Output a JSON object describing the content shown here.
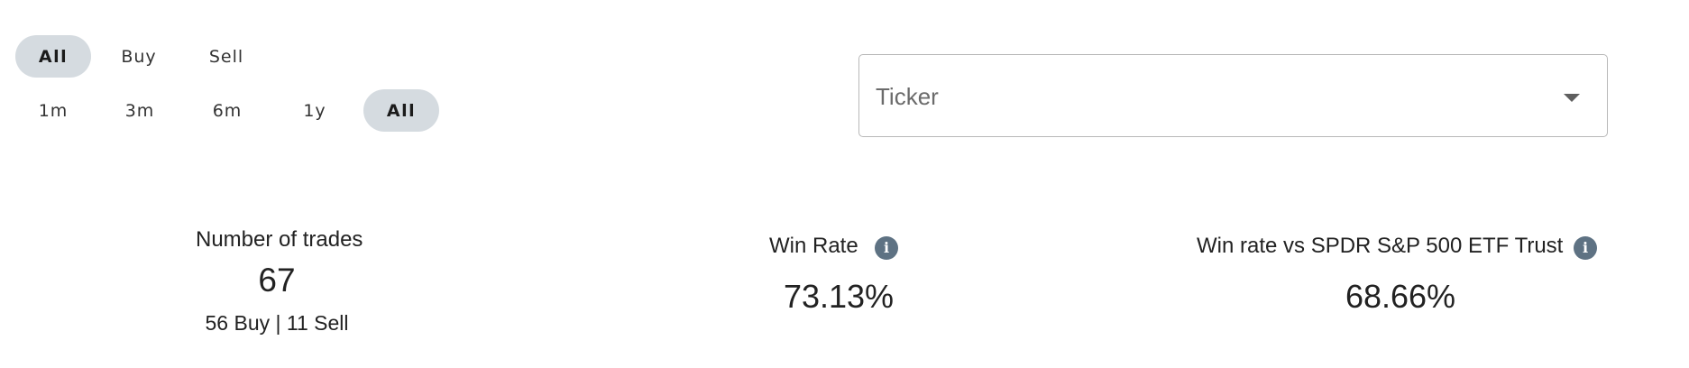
{
  "filters": {
    "side": [
      {
        "label": "All",
        "active": true
      },
      {
        "label": "Buy",
        "active": false
      },
      {
        "label": "Sell",
        "active": false
      }
    ],
    "period": [
      {
        "label": "1m",
        "active": false
      },
      {
        "label": "3m",
        "active": false
      },
      {
        "label": "6m",
        "active": false
      },
      {
        "label": "1y",
        "active": false
      },
      {
        "label": "All",
        "active": true
      }
    ]
  },
  "ticker": {
    "label": "Ticker",
    "icon": "chevron-down-icon"
  },
  "stats": {
    "trades": {
      "label": "Number of trades",
      "value": "67",
      "breakdown": "56 Buy | 11 Sell"
    },
    "win_rate": {
      "label": "Win Rate",
      "value": "73.13%",
      "icon": "info-icon"
    },
    "win_vs_spy": {
      "label": "Win rate vs SPDR S&P 500 ETF Trust",
      "value": "68.66%",
      "icon": "info-icon"
    }
  },
  "colors": {
    "chip_active_bg": "#d5dbe0",
    "info_icon_bg": "#5e7283"
  }
}
